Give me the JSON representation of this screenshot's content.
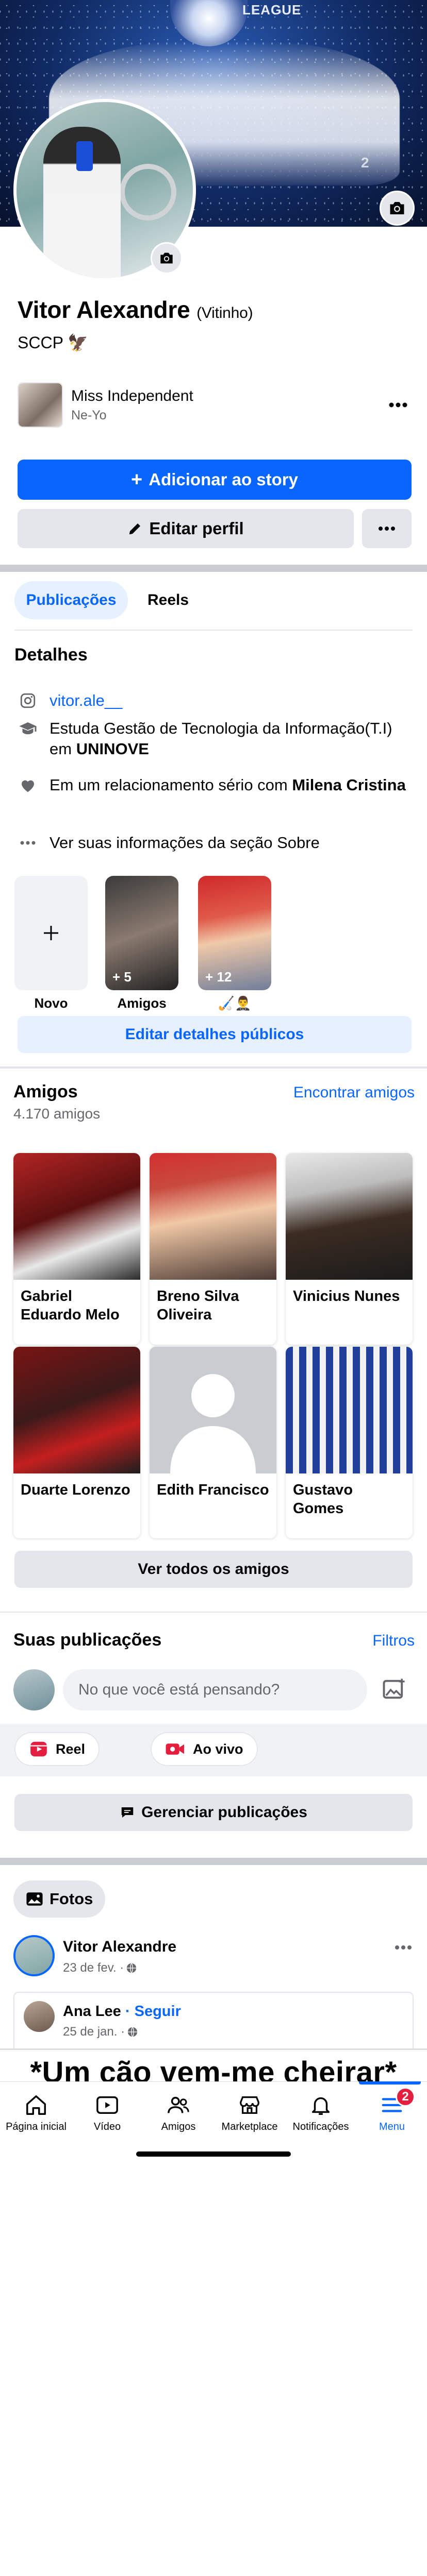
{
  "profile": {
    "name": "Vitor Alexandre",
    "nickname": "(Vitinho)",
    "bio": "SCCP 🦅",
    "cover_caption": "LEAGUE",
    "cover_caption_2": "2"
  },
  "music": {
    "title": "Miss Independent",
    "artist": "Ne-Yo"
  },
  "actions": {
    "add_story": "Adicionar ao story",
    "edit_profile": "Editar perfil"
  },
  "tabs": [
    {
      "label": "Publicações",
      "active": true
    },
    {
      "label": "Reels",
      "active": false
    }
  ],
  "details": {
    "heading": "Detalhes",
    "instagram": "vitor.ale__",
    "study_prefix": "Estuda Gestão de Tecnologia da Informação(T.I) em ",
    "study_school": "UNINOVE",
    "relationship_prefix": "Em um relacionamento sério com ",
    "relationship_partner": "Milena Cristina",
    "see_about": "Ver suas informações da seção Sobre"
  },
  "highlights": [
    {
      "label": "Novo",
      "count": ""
    },
    {
      "label": "Amigos",
      "count": "+ 5"
    },
    {
      "label": "🏑🤵‍♂️",
      "count": "+ 12"
    }
  ],
  "edit_public_details": "Editar detalhes públicos",
  "friends": {
    "heading": "Amigos",
    "count": "4.170 amigos",
    "find_link": "Encontrar amigos",
    "list": [
      {
        "name": "Gabriel Eduardo Melo"
      },
      {
        "name": "Breno Silva Oliveira"
      },
      {
        "name": "Vinicius Nunes"
      },
      {
        "name": "Duarte Lorenzo"
      },
      {
        "name": "Edith Francisco"
      },
      {
        "name": "Gustavo Gomes"
      }
    ],
    "see_all": "Ver todos os amigos"
  },
  "posts": {
    "heading": "Suas publicações",
    "filters": "Filtros",
    "composer_placeholder": "No que você está pensando?",
    "reel_label": "Reel",
    "live_label": "Ao vivo",
    "manage": "Gerenciar publicações"
  },
  "photos_chip": "Fotos",
  "post": {
    "author": "Vitor Alexandre",
    "date": "23 de fev. · ",
    "shared_author": "Ana Lee",
    "shared_follow": "Seguir",
    "shared_date": "25 de jan. · "
  },
  "meme_text": "*Um cão vem-me cheirar*",
  "tabbar": [
    {
      "label": "Página inicial",
      "icon": "home-icon"
    },
    {
      "label": "Vídeo",
      "icon": "video-icon"
    },
    {
      "label": "Amigos",
      "icon": "friends-icon"
    },
    {
      "label": "Marketplace",
      "icon": "marketplace-icon"
    },
    {
      "label": "Notificações",
      "icon": "bell-icon"
    },
    {
      "label": "Menu",
      "icon": "menu-icon",
      "active": true,
      "badge": "2"
    }
  ],
  "colors": {
    "accent": "#0866ff",
    "button_gray": "#e4e6eb",
    "badge_red": "#e41e3f"
  }
}
